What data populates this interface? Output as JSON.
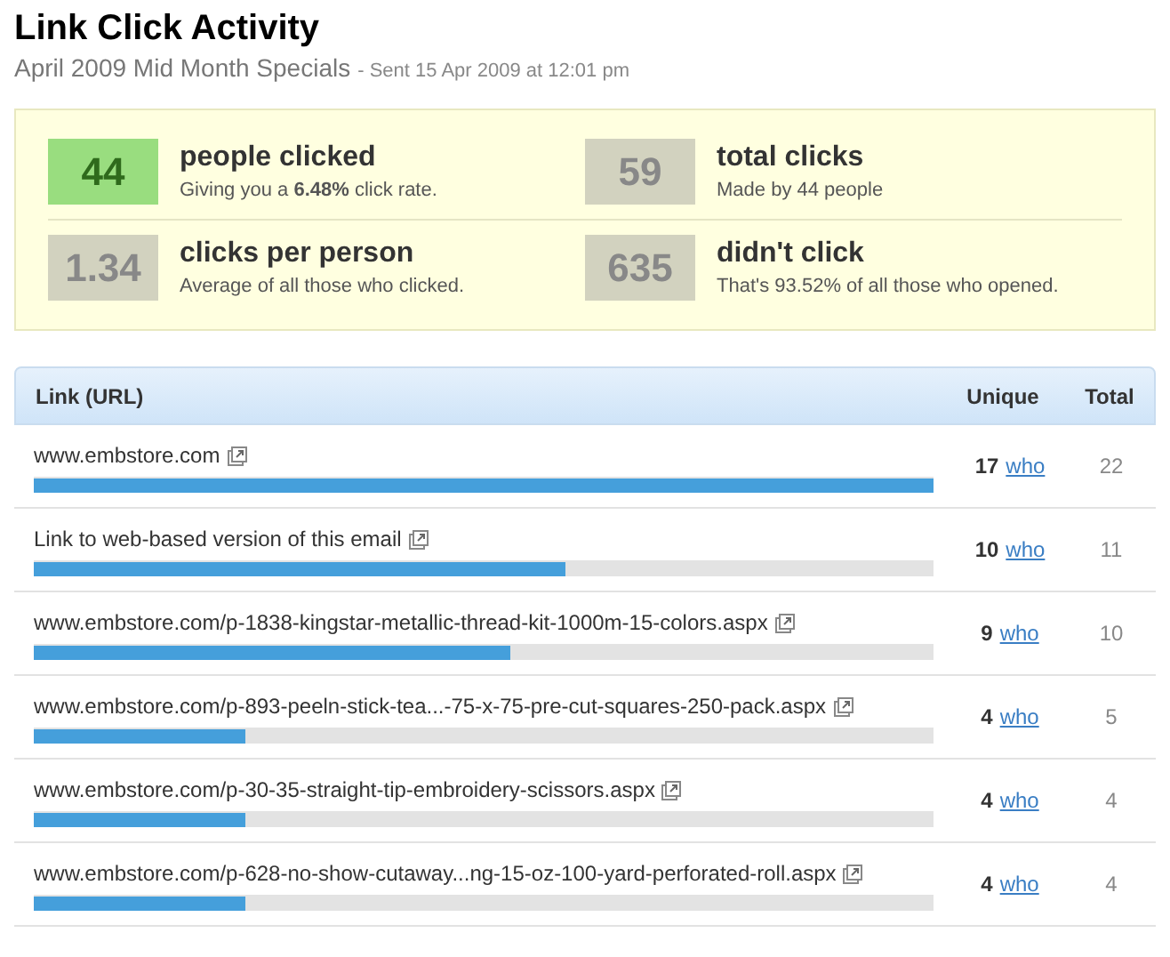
{
  "title": "Link Click Activity",
  "subtitle": {
    "campaign": "April 2009 Mid Month Specials",
    "sent": "- Sent 15 Apr 2009 at 12:01 pm"
  },
  "stats": [
    {
      "value": "44",
      "highlight": true,
      "label": "people clicked",
      "detail": "Giving you a **6.48%** click rate."
    },
    {
      "value": "59",
      "highlight": false,
      "label": "total clicks",
      "detail": "Made by 44 people"
    },
    {
      "value": "1.34",
      "highlight": false,
      "label": "clicks per person",
      "detail": "Average of all those who clicked."
    },
    {
      "value": "635",
      "highlight": false,
      "label": "didn't click",
      "detail": "That's 93.52% of all those who opened."
    }
  ],
  "table": {
    "columns": [
      "Link (URL)",
      "Unique",
      "Total"
    ],
    "rows": [
      {
        "link": "www.embstore.com",
        "level": 1,
        "unique": "17",
        "who": "who",
        "total": "22"
      },
      {
        "link": "Link to web-based version of this email",
        "level": 0.59,
        "unique": "10",
        "who": "who",
        "total": "11"
      },
      {
        "link": "www.embstore.com/p-1838-kingstar-metallic-thread-kit-1000m-15-colors.aspx",
        "level": 0.53,
        "unique": "9",
        "who": "who",
        "total": "10"
      },
      {
        "link": "www.embstore.com/p-893-peeln-stick-tea...-75-x-75-pre-cut-squares-250-pack.aspx",
        "level": 0.235,
        "unique": "4",
        "who": "who",
        "total": "5"
      },
      {
        "link": "www.embstore.com/p-30-35-straight-tip-embroidery-scissors.aspx",
        "level": 0.235,
        "unique": "4",
        "who": "who",
        "total": "4"
      },
      {
        "link": "www.embstore.com/p-628-no-show-cutaway...ng-15-oz-100-yard-perforated-roll.aspx",
        "level": 0.235,
        "unique": "4",
        "who": "who",
        "total": "4"
      }
    ]
  }
}
